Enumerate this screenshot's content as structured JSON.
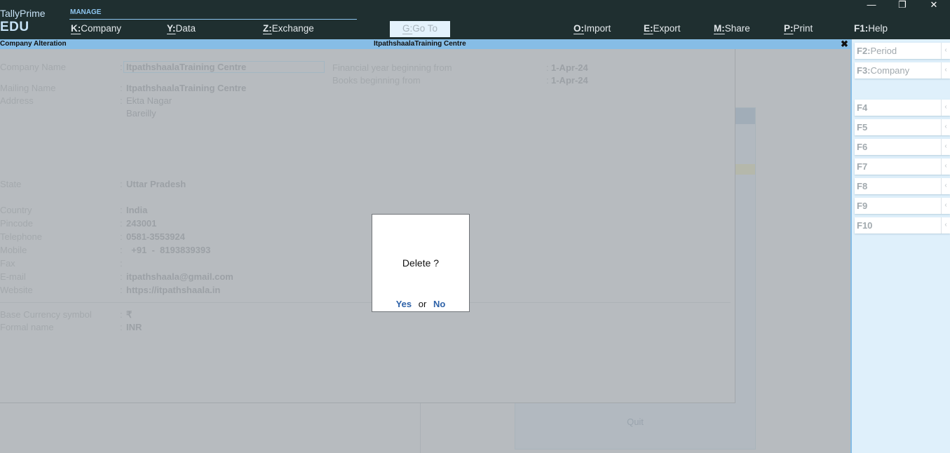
{
  "app": {
    "brand_name": "TallyPrime",
    "brand_edition": "EDU"
  },
  "topbar": {
    "section_label": "MANAGE",
    "menu": [
      {
        "key": "K:",
        "label": "Company"
      },
      {
        "key": "Y:",
        "label": "Data"
      },
      {
        "key": "Z:",
        "label": "Exchange"
      },
      {
        "key": "G:",
        "label": "Go To"
      },
      {
        "key": "O:",
        "label": "Import"
      },
      {
        "key": "E:",
        "label": "Export"
      },
      {
        "key": "M:",
        "label": "Share"
      },
      {
        "key": "P:",
        "label": "Print"
      },
      {
        "key": "F1:",
        "label": "Help"
      }
    ],
    "window_controls": {
      "minimize": "—",
      "restore": "❐",
      "close": "✕"
    }
  },
  "titlebar": {
    "screen_title": "Company  Alteration",
    "company": "ItpathshaalaTraining Centre",
    "close_icon": "✖"
  },
  "rightbar": {
    "buttons": [
      {
        "key": "F2:",
        "label": "Period"
      },
      {
        "key": "F3:",
        "label": "Company"
      },
      {
        "key": "F4",
        "label": ""
      },
      {
        "key": "F5",
        "label": ""
      },
      {
        "key": "F6",
        "label": ""
      },
      {
        "key": "F7",
        "label": ""
      },
      {
        "key": "F8",
        "label": ""
      },
      {
        "key": "F9",
        "label": ""
      },
      {
        "key": "F10",
        "label": ""
      }
    ],
    "chevron": "‹"
  },
  "form": {
    "colon": ":",
    "company_name": {
      "label": "Company Name",
      "value": "ItpathshaalaTraining Centre"
    },
    "mailing_name": {
      "label": "Mailing Name",
      "value": "ItpathshaalaTraining Centre"
    },
    "address": {
      "label": "Address",
      "lines": [
        "Ekta Nagar",
        "Bareilly"
      ]
    },
    "state": {
      "label": "State",
      "value": "Uttar Pradesh"
    },
    "country": {
      "label": "Country",
      "value": "India"
    },
    "pincode": {
      "label": "Pincode",
      "value": "243001"
    },
    "telephone": {
      "label": "Telephone",
      "value": "0581-3553924"
    },
    "mobile": {
      "label": "Mobile",
      "value": "  +91  -  8193839393"
    },
    "fax": {
      "label": "Fax",
      "value": ""
    },
    "email": {
      "label": "E-mail",
      "value": "itpathshaala@gmail.com"
    },
    "website": {
      "label": "Website",
      "value": "https://itpathshaala.in"
    },
    "base_currency_symbol": {
      "label": "Base Currency symbol",
      "value": "₹"
    },
    "formal_name": {
      "label": "Formal name",
      "value": "INR"
    },
    "financial_year": {
      "label": "Financial year beginning from",
      "value": "1-Apr-24"
    },
    "books_beginning": {
      "label": "Books beginning from",
      "value": "1-Apr-24"
    }
  },
  "background_panel": {
    "quit_label": "Quit"
  },
  "dialog": {
    "question": "Delete ?",
    "yes": "Yes",
    "or": "or",
    "no": "No"
  }
}
